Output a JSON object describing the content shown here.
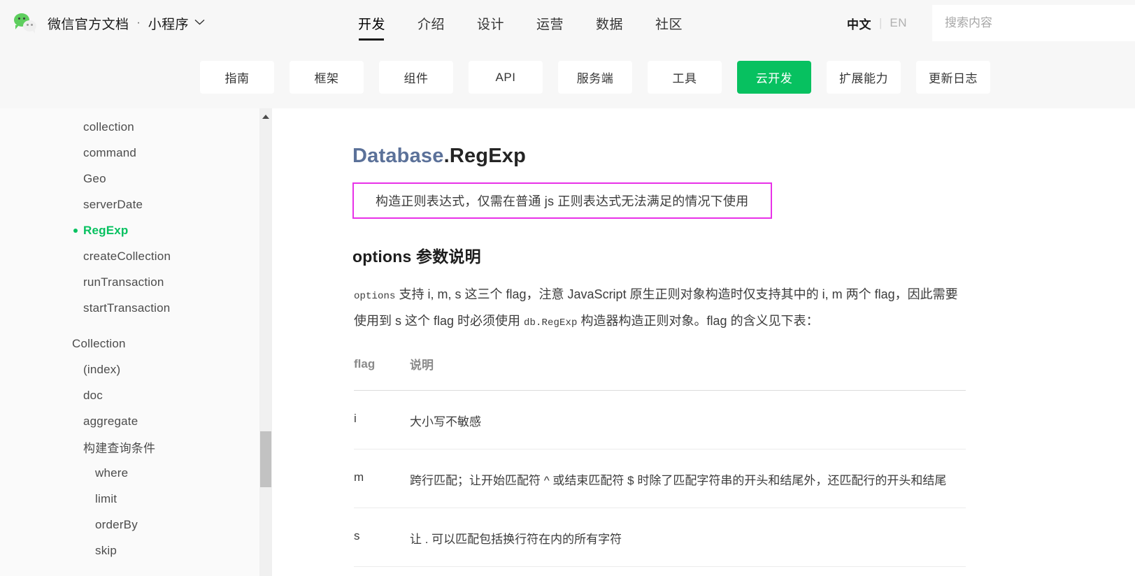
{
  "header": {
    "logo_icon": "wechat-logo-icon",
    "brand_title": "微信官方文档",
    "brand_separator": "·",
    "brand_sub": "小程序",
    "chevron_icon": "chevron-down-icon",
    "nav": [
      {
        "label": "开发",
        "active": true
      },
      {
        "label": "介绍",
        "active": false
      },
      {
        "label": "设计",
        "active": false
      },
      {
        "label": "运营",
        "active": false
      },
      {
        "label": "数据",
        "active": false
      },
      {
        "label": "社区",
        "active": false
      }
    ],
    "lang": {
      "cn": "中文",
      "separator": "|",
      "en": "EN"
    },
    "search": {
      "value": "",
      "placeholder": "搜索内容",
      "icon": "search-icon"
    }
  },
  "subnav": {
    "items": [
      {
        "label": "指南",
        "active": false
      },
      {
        "label": "框架",
        "active": false
      },
      {
        "label": "组件",
        "active": false
      },
      {
        "label": "API",
        "active": false
      },
      {
        "label": "服务端",
        "active": false
      },
      {
        "label": "工具",
        "active": false
      },
      {
        "label": "云开发",
        "active": true
      },
      {
        "label": "扩展能力",
        "active": false
      },
      {
        "label": "更新日志",
        "active": false
      }
    ],
    "active_color": "#07c160"
  },
  "sidebar": {
    "active_color": "#07c160",
    "items": [
      {
        "label": "collection",
        "level": 1,
        "active": false
      },
      {
        "label": "command",
        "level": 1,
        "active": false
      },
      {
        "label": "Geo",
        "level": 1,
        "active": false
      },
      {
        "label": "serverDate",
        "level": 1,
        "active": false
      },
      {
        "label": "RegExp",
        "level": 1,
        "active": true
      },
      {
        "label": "createCollection",
        "level": 1,
        "active": false
      },
      {
        "label": "runTransaction",
        "level": 1,
        "active": false
      },
      {
        "label": "startTransaction",
        "level": 1,
        "active": false
      },
      {
        "label": "Collection",
        "level": 0,
        "active": false,
        "gap_before": true
      },
      {
        "label": "(index)",
        "level": 1,
        "active": false
      },
      {
        "label": "doc",
        "level": 1,
        "active": false
      },
      {
        "label": "aggregate",
        "level": 1,
        "active": false
      },
      {
        "label": "构建查询条件",
        "level": 1,
        "active": false
      },
      {
        "label": "where",
        "level": 2,
        "active": false
      },
      {
        "label": "limit",
        "level": 2,
        "active": false
      },
      {
        "label": "orderBy",
        "level": 2,
        "active": false
      },
      {
        "label": "skip",
        "level": 2,
        "active": false
      }
    ],
    "scrollbar": {
      "up_arrow_icon": "scroll-up-arrow-icon"
    }
  },
  "content": {
    "title_namespace": "Database",
    "title_member": ".RegExp",
    "highlight": {
      "text": "构造正则表达式，仅需在普通 js 正则表达式无法满足的情况下使用",
      "border_color": "#e832e8"
    },
    "section_heading": "options 参数说明",
    "paragraph": {
      "code1": "options",
      "text1": " 支持 i, m, s 这三个 flag，注意 JavaScript 原生正则对象构造时仅支持其中的 i, m 两个 flag，因此需要使用到 s 这个 flag 时必须使用 ",
      "code2": "db.RegExp",
      "text2": " 构造器构造正则对象。flag 的含义见下表："
    },
    "table": {
      "headers": [
        "flag",
        "说明"
      ],
      "rows": [
        [
          "i",
          "大小写不敏感"
        ],
        [
          "m",
          "跨行匹配；让开始匹配符 ^ 或结束匹配符 $ 时除了匹配字符串的开头和结尾外，还匹配行的开头和结尾"
        ],
        [
          "s",
          "让 . 可以匹配包括换行符在内的所有字符"
        ]
      ]
    }
  }
}
